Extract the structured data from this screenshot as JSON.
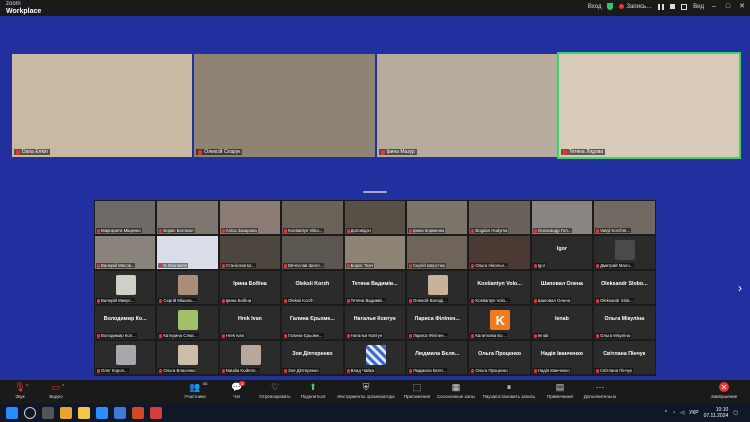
{
  "app": {
    "logo_top": "zoom",
    "logo_bottom": "Workplace"
  },
  "titlebar": {
    "login": "Вход",
    "record": "Запись…",
    "view": "Вид"
  },
  "speakers": [
    {
      "name": "Dana Enkin",
      "bg": "#c9b9a3",
      "active": false
    },
    {
      "name": "Олексій Сігарук",
      "bg": "#8f8374",
      "active": false
    },
    {
      "name": "Ірина Мазур",
      "bg": "#b7ab9e",
      "active": false
    },
    {
      "name": "Тетяна Лядова",
      "bg": "#d8cbb8",
      "active": true
    }
  ],
  "gallery": [
    [
      {
        "name": "Маргарита Міщенко",
        "type": "video",
        "bg": "#6e6a68"
      },
      {
        "name": "Борис Богомол",
        "type": "video",
        "bg": "#7d7770"
      },
      {
        "name": "Аліса Захарова",
        "type": "video",
        "bg": "#8a7c72"
      },
      {
        "name": "Kostiantyn Vitko...",
        "type": "video",
        "bg": "#6b6358"
      },
      {
        "name": "Доповідач",
        "type": "video",
        "bg": "#584f46"
      },
      {
        "name": "Ірина Корженко",
        "type": "video",
        "bg": "#7c7569"
      },
      {
        "name": "Bogdan Hudyma",
        "type": "video",
        "bg": "#6a625a"
      },
      {
        "name": "Олександр Гол...",
        "type": "video",
        "bg": "#8a8580"
      },
      {
        "name": "Vasyl Korchm...",
        "type": "video",
        "bg": "#706a62"
      }
    ],
    [
      {
        "name": "Валерій Мясов...",
        "type": "video",
        "bg": "#8b847c"
      },
      {
        "name": "N Shandarin",
        "type": "video",
        "bg": "#d9dde8"
      },
      {
        "name": "Станіслав Ш...",
        "type": "video",
        "bg": "#4d463f"
      },
      {
        "name": "Вячеслав Шелл...",
        "type": "video",
        "bg": "#5c5650"
      },
      {
        "name": "Борис Ткач",
        "type": "video",
        "bg": "#8e8476"
      },
      {
        "name": "Сергій Шерстюк",
        "type": "video",
        "bg": "#6f6459"
      },
      {
        "name": "Ольга Нікольн...",
        "type": "video",
        "bg": "#4b3a33"
      },
      {
        "name": "Igor",
        "type": "name",
        "big": "Igor"
      },
      {
        "name": "Дмитрий Мало...",
        "type": "photo",
        "bg": "#4a4a4a"
      }
    ],
    [
      {
        "name": "Валерій Микул...",
        "type": "photo",
        "bg": "#cfcfc6"
      },
      {
        "name": "Сергій Мішаль...",
        "type": "photo",
        "bg": "#a98f7a"
      },
      {
        "name": "Ірина Бобіна",
        "type": "name",
        "big": "Ірина Бобіна"
      },
      {
        "name": "Oleksii Korzh",
        "type": "name",
        "big": "Oleksii Korzh"
      },
      {
        "name": "Тетяна Вадимів...",
        "type": "name",
        "big": "Тетяна Вадимів..."
      },
      {
        "name": "Олексій Володі...",
        "type": "photo",
        "bg": "#c8b39a"
      },
      {
        "name": "Kostiantyn Volo...",
        "type": "name",
        "big": "Kostiantyn Volo..."
      },
      {
        "name": "Шаповал Олена",
        "type": "name",
        "big": "Шаповал Олена"
      },
      {
        "name": "Oleksandr Slob...",
        "type": "name",
        "big": "Oleksandr Slobo..."
      }
    ],
    [
      {
        "name": "Володимир Кол...",
        "type": "name",
        "big": "Володимир Ко..."
      },
      {
        "name": "Катерина Слюс...",
        "type": "photo",
        "bg": "#9fbf6a"
      },
      {
        "name": "Hrek Ivan",
        "type": "name",
        "big": "Hrek Ivan"
      },
      {
        "name": "Галина Єрьоме...",
        "type": "name",
        "big": "Галина Єрьоме..."
      },
      {
        "name": "Наталья Ковтун",
        "type": "name",
        "big": "Наталья Ковтун"
      },
      {
        "name": "Лариса Філіпен...",
        "type": "name",
        "big": "Лариса Філіпен..."
      },
      {
        "name": "Калиткова Бо...",
        "type": "k",
        "letter": "K"
      },
      {
        "name": "Ienab",
        "type": "name",
        "big": "Ienab"
      },
      {
        "name": "Ольга Мікуліна",
        "type": "name",
        "big": "Ольга Мікуліна"
      }
    ],
    [
      {
        "name": "Олег Корол...",
        "type": "photo",
        "bg": "#a7a8ad"
      },
      {
        "name": "Ольга Власенко",
        "type": "photo",
        "bg": "#cdbda8"
      },
      {
        "name": "Natalia Kudrem...",
        "type": "photo",
        "bg": "#b7a89a"
      },
      {
        "name": "Зоя Діптеренко",
        "type": "name",
        "big": "Зоя Діптеренко"
      },
      {
        "name": "Влад Чайка",
        "type": "pat"
      },
      {
        "name": "Людмила Бєля...",
        "type": "name",
        "big": "Людмила Бєля..."
      },
      {
        "name": "Ольга Проценко",
        "type": "name",
        "big": "Ольга Проценко"
      },
      {
        "name": "Надія Іванченко",
        "type": "name",
        "big": "Надія Іванченко"
      },
      {
        "name": "Світлана Пінчук",
        "type": "name",
        "big": "Світлана Пінчук"
      }
    ]
  ],
  "toolbar": {
    "audio": "Звук",
    "video": "Видео",
    "participants": "Участники",
    "participants_count": "86",
    "chat": "Чат",
    "chat_badge": "1",
    "react": "Отреагировать",
    "share": "Поделиться",
    "host_tools": "Инструменты организатора",
    "apps": "Приложения",
    "rooms": "Сессионные залы",
    "record": "Пауза/остановить запись",
    "captions": "Примечания",
    "more": "Дополнительно",
    "end": "Завершение"
  },
  "taskbar": {
    "lang": "УКР",
    "time": "10:10",
    "date": "07.11.2024"
  }
}
